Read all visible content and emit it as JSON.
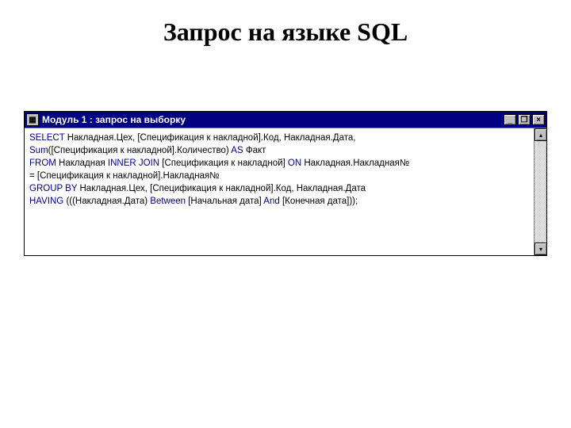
{
  "heading": "Запрос на языке SQL",
  "window": {
    "title": "Модуль 1 : запрос на выборку",
    "icon_glyph": "▦",
    "minimize_glyph": "_",
    "restore_glyph": "❐",
    "close_glyph": "×",
    "scroll_up_glyph": "▴",
    "scroll_down_glyph": "▾"
  },
  "sql": {
    "l1a": "SELECT",
    "l1b": " Накладная.Цех, [Спецификация к накладной].Код, Накладная.Дата,",
    "l2a": "Sum",
    "l2b": "([Спецификация к накладной].Количество) ",
    "l2c": "AS",
    "l2d": " Факт",
    "l3a": "FROM",
    "l3b": " Накладная ",
    "l3c": "INNER JOIN",
    "l3d": " [Спецификация к накладной] ",
    "l3e": "ON",
    "l3f": " Накладная.Накладная№",
    "l4": "= [Спецификация к накладной].Накладная№",
    "l5a": "GROUP BY",
    "l5b": " Накладная.Цех, [Спецификация к накладной].Код, Накладная.Дата",
    "l6a": "HAVING",
    "l6b": " (((Накладная.Дата) ",
    "l6c": "Between",
    "l6d": " [Начальная дата] ",
    "l6e": "And",
    "l6f": " [Конечная дата]));"
  }
}
